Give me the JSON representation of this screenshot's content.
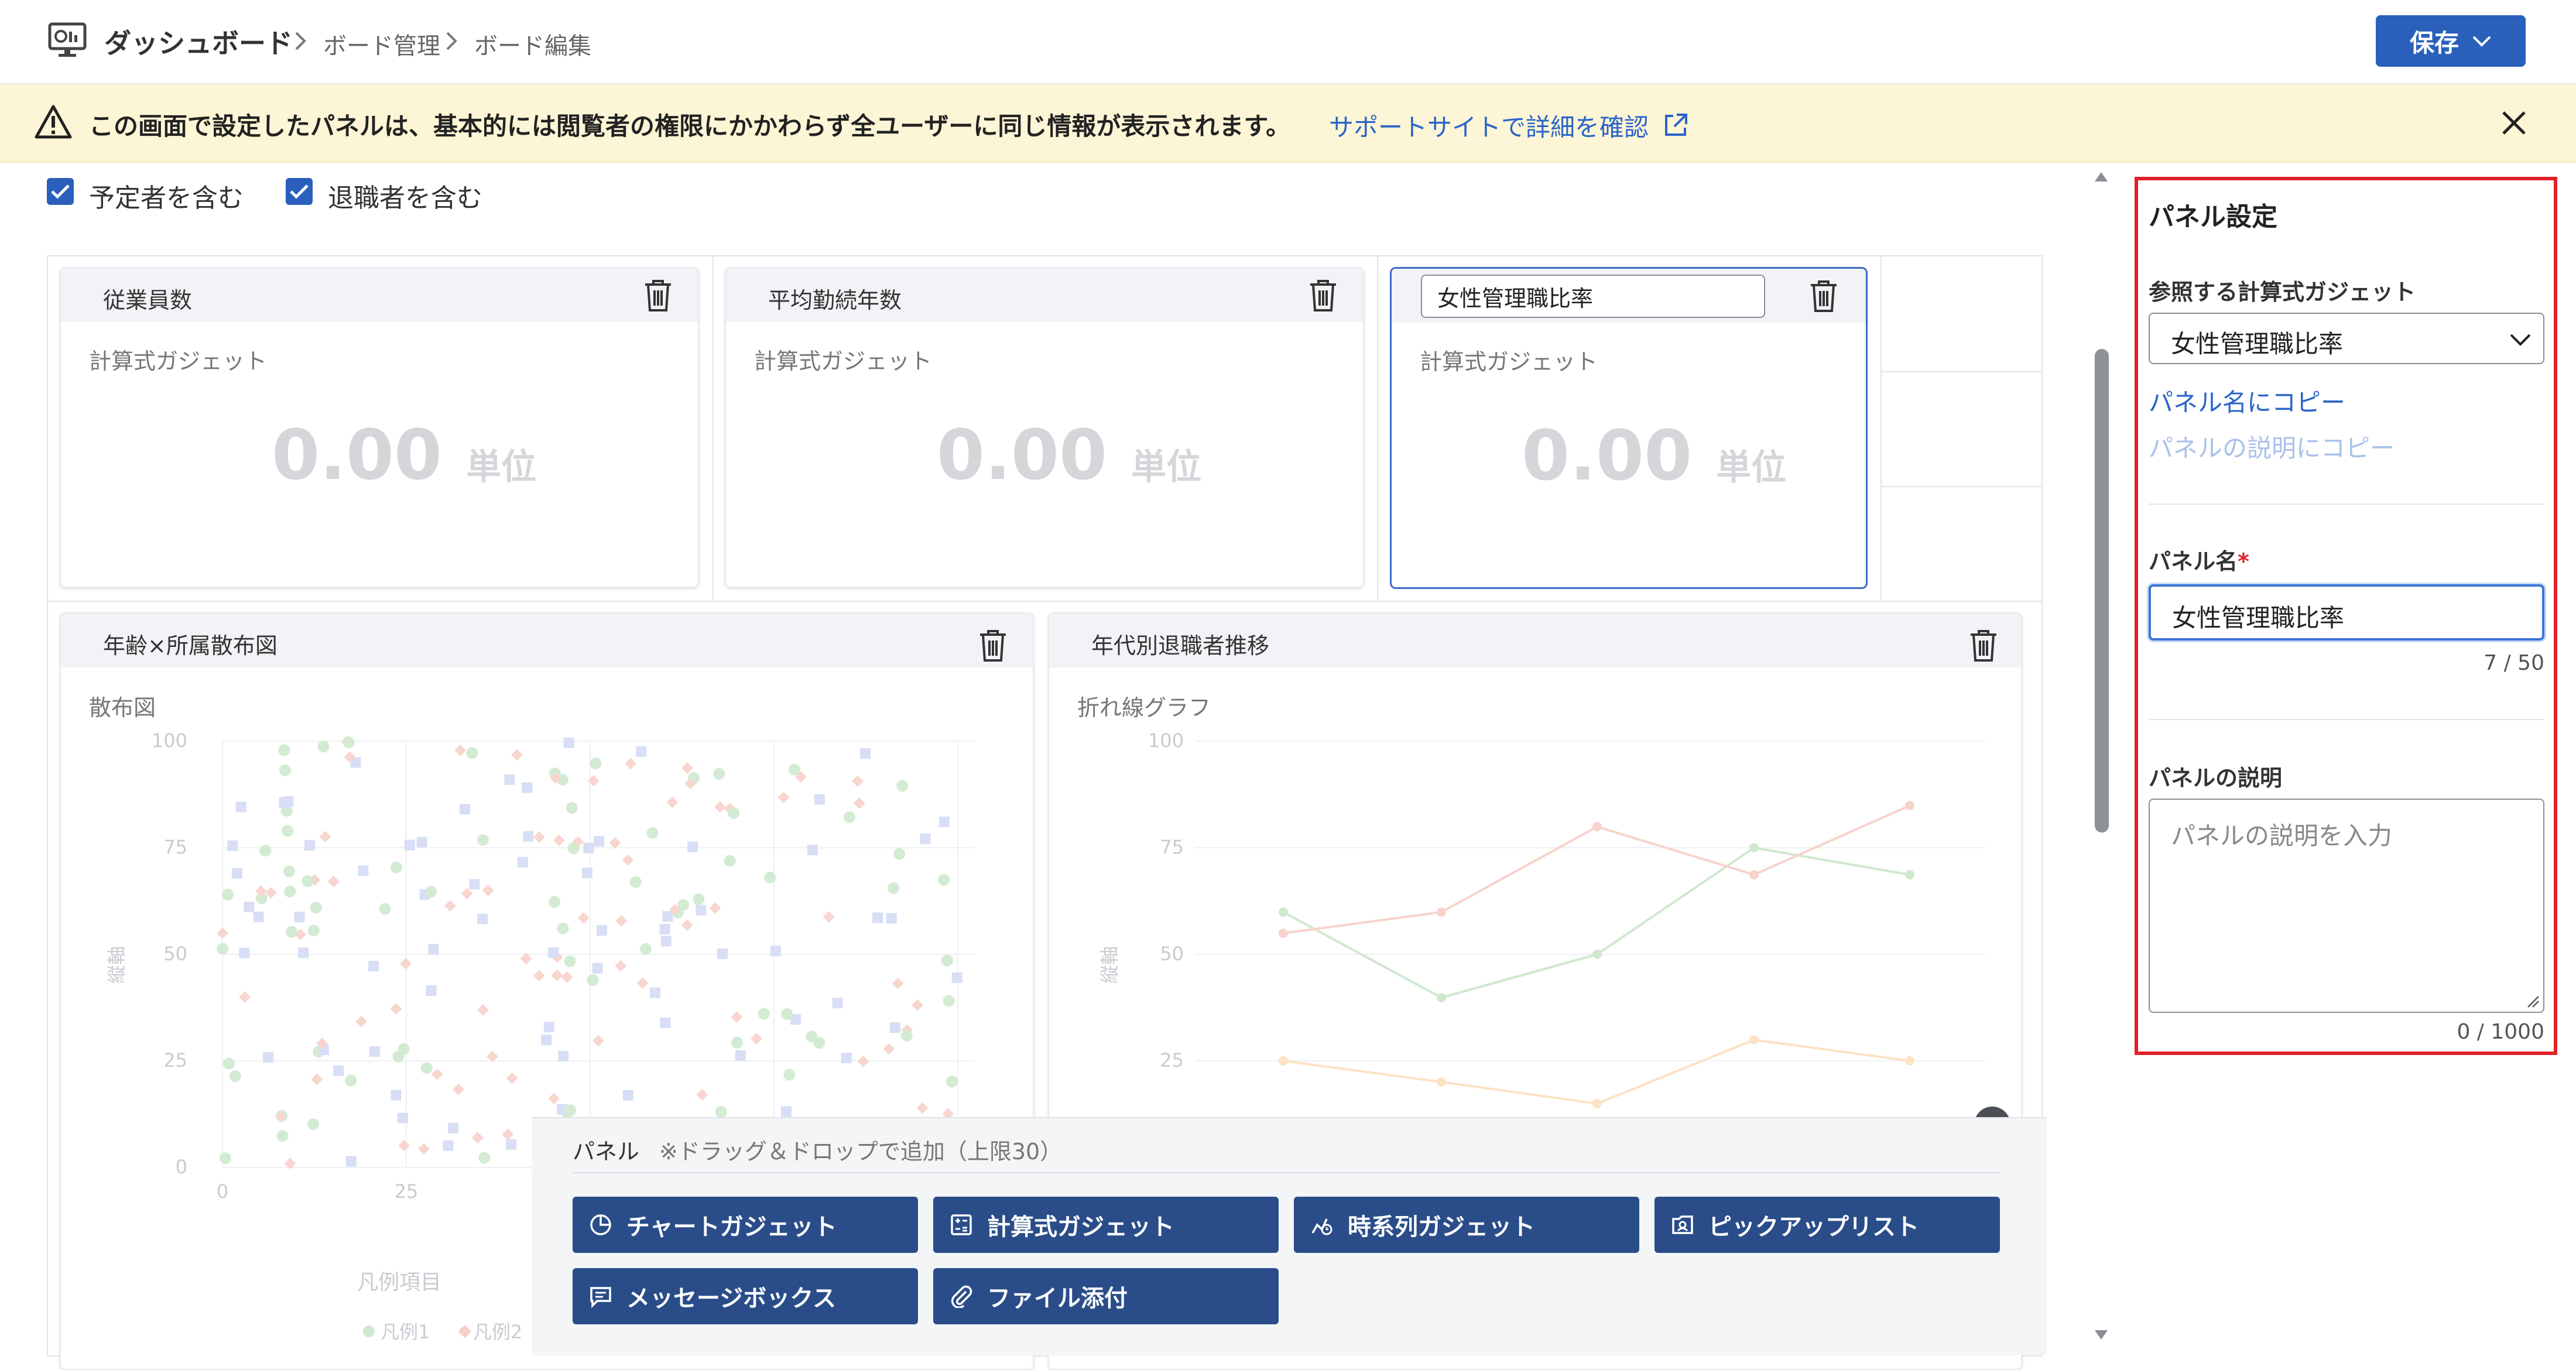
{
  "header": {
    "title": "ダッシュボード",
    "breadcrumbs": [
      "ボード管理",
      "ボード編集"
    ],
    "save_label": "保存"
  },
  "banner": {
    "message": "この画面で設定したパネルは、基本的には閲覧者の権限にかかわらず全ユーザーに同じ情報が表示されます。",
    "link": "サポートサイトで詳細を確認"
  },
  "filters": {
    "include_scheduled": "予定者を含む",
    "include_retired": "退職者を含む"
  },
  "cards": [
    {
      "title": "従業員数",
      "subtitle": "計算式ガジェット",
      "value": "0.00",
      "unit": "単位"
    },
    {
      "title": "平均勤続年数",
      "subtitle": "計算式ガジェット",
      "value": "0.00",
      "unit": "単位"
    },
    {
      "title": "女性管理職比率",
      "subtitle": "計算式ガジェット",
      "value": "0.00",
      "unit": "単位"
    }
  ],
  "scatter_panel": {
    "title": "年齢×所属散布図",
    "subtitle": "散布図",
    "y_axis_label": "縦軸",
    "y_ticks": [
      "100",
      "75",
      "50",
      "25",
      "0"
    ],
    "x_ticks": [
      "0",
      "25"
    ],
    "legend_title": "凡例項目",
    "legend": [
      "凡例1",
      "凡例2"
    ]
  },
  "line_panel": {
    "title": "年代別退職者推移",
    "subtitle": "折れ線グラフ",
    "y_axis_label": "縦軸",
    "y_ticks": [
      "100",
      "75",
      "50",
      "25"
    ]
  },
  "palette": {
    "title": "パネル",
    "hint": "※ドラッグ＆ドロップで追加（上限30）",
    "buttons": [
      "チャートガジェット",
      "計算式ガジェット",
      "時系列ガジェット",
      "ピックアップリスト",
      "メッセージボックス",
      "ファイル添付"
    ]
  },
  "settings": {
    "heading": "パネル設定",
    "gadget_label": "参照する計算式ガジェット",
    "gadget_value": "女性管理職比率",
    "copy_name": "パネル名にコピー",
    "copy_desc": "パネルの説明にコピー",
    "name_label": "パネル名",
    "required_mark": "*",
    "name_value": "女性管理職比率",
    "name_counter": "7 / 50",
    "desc_label": "パネルの説明",
    "desc_placeholder": "パネルの説明を入力",
    "desc_counter": "0 / 1000"
  },
  "colors": {
    "accent": "#2a5fbc",
    "palette_button": "#2a4d89",
    "highlight": "#e0202a",
    "banner": "#fdf6d6"
  },
  "icons": [
    "dashboard-icon",
    "chevron-right-icon",
    "chevron-down-icon",
    "warning-icon",
    "external-link-icon",
    "close-icon",
    "check-icon",
    "trash-icon",
    "collapse-icon",
    "chart-icon",
    "calculator-icon",
    "timeseries-icon",
    "picklist-icon",
    "message-icon",
    "paperclip-icon"
  ]
}
